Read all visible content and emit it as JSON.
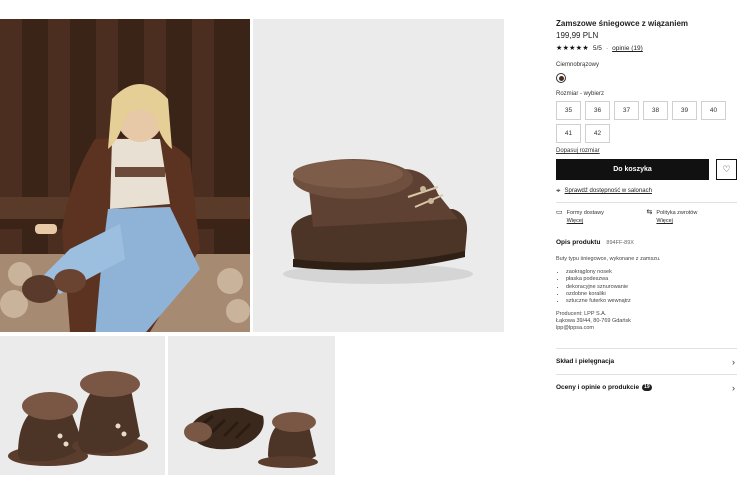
{
  "product": {
    "title": "Zamszowe śniegowce z wiązaniem",
    "price": "199,99 PLN",
    "rating": {
      "stars": 5,
      "score": "5/5",
      "dot": "·",
      "reviews_label": "opinie (19)"
    },
    "color_label": "Ciemnobrązowy",
    "color_hex": "#4a2c22",
    "size_label": "Rozmiar - wybierz",
    "sizes": [
      "35",
      "36",
      "37",
      "38",
      "39",
      "40",
      "41",
      "42"
    ],
    "fit_link": "Dopasuj rozmiar",
    "add_to_cart": "Do koszyka",
    "store_check": "Sprawdź dostępność w salonach",
    "delivery": {
      "title": "Formy dostawy",
      "link": "Więcej"
    },
    "returns": {
      "title": "Polityka zwrotów",
      "link": "Więcej"
    },
    "description": {
      "heading": "Opis produktu",
      "code": "894FF-89X",
      "text": "Buty typu śniegowce, wykonane z zamszu.",
      "features": [
        "zaokrąglony nosek",
        "płaska podeszwa",
        "dekoracyjne sznurowanie",
        "ozdobne koraliki",
        "sztuczne futerko wewnątrz"
      ],
      "producer_line1": "Producent: LPP S.A.",
      "producer_line2": "Łąkowa 39/44, 80-769 Gdańsk",
      "producer_line3": "lpp@lppsa.com"
    },
    "accordion": {
      "composition": "Skład i pielęgnacja",
      "reviews": "Oceny i opinie o produkcie",
      "reviews_badge": "19"
    }
  },
  "icons": {
    "star": "★",
    "heart": "♡",
    "pin": "⌖",
    "truck": "▭",
    "return": "⇆",
    "chevron": "›"
  }
}
